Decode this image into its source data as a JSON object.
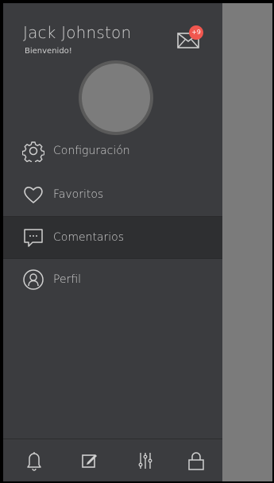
{
  "user": {
    "name": "Jack Johnston",
    "greeting": "Bienvenido!"
  },
  "mail": {
    "badge": "+9",
    "icon": "envelope-icon",
    "badge_color": "#f0574f"
  },
  "menu": [
    {
      "label": "Configuración",
      "icon": "gear-icon",
      "active": false
    },
    {
      "label": "Favoritos",
      "icon": "heart-icon",
      "active": false
    },
    {
      "label": "Comentarios",
      "icon": "chat-bubble-icon",
      "active": true
    },
    {
      "label": "Perfil",
      "icon": "user-circle-icon",
      "active": false
    }
  ],
  "bottom_bar": [
    {
      "icon": "bell-icon"
    },
    {
      "icon": "edit-icon"
    },
    {
      "icon": "sliders-icon"
    },
    {
      "icon": "lock-icon"
    }
  ],
  "colors": {
    "drawer_bg": "#3b3c3f",
    "active_bg": "#2e2f31",
    "overlay_bg": "#7b7b7b",
    "text": "#d0d0d0"
  }
}
